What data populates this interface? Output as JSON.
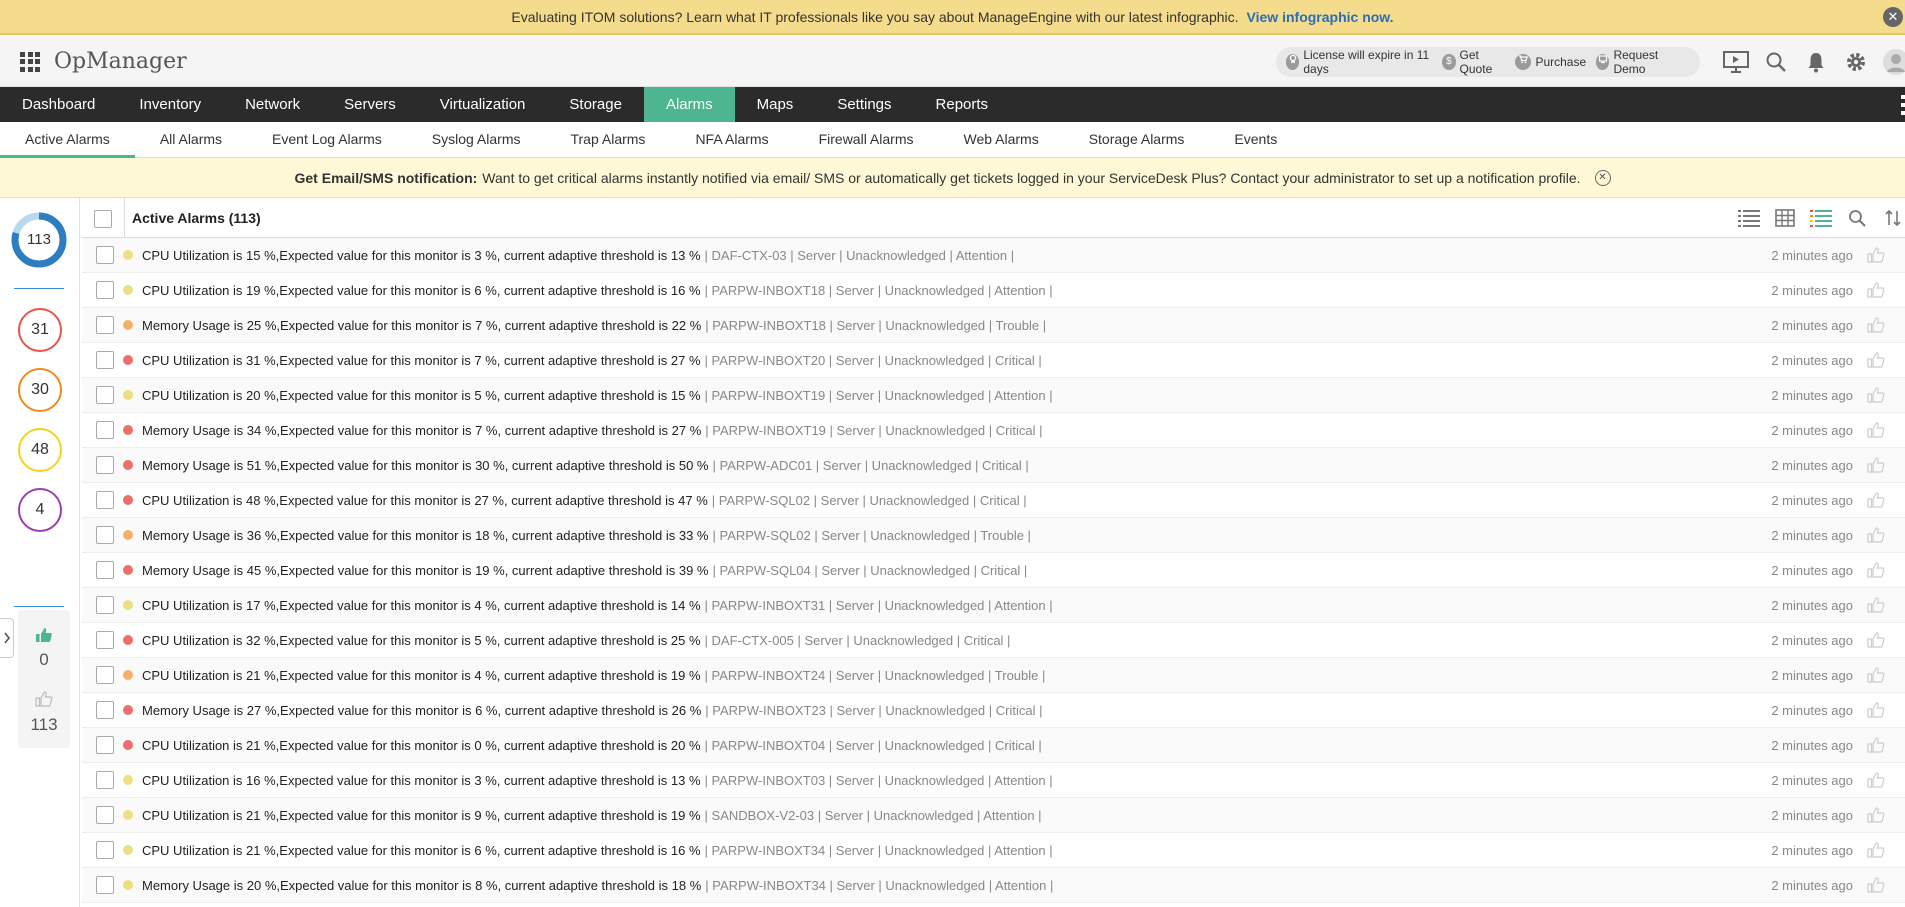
{
  "banner": {
    "text": "Evaluating ITOM solutions? Learn what IT professionals like you say about ManageEngine with our latest infographic.",
    "link": "View infographic now.",
    "close_glyph": "✕"
  },
  "header": {
    "brand": "OpManager",
    "license": "License will expire in 11 days",
    "get_quote": "Get Quote",
    "purchase": "Purchase",
    "request_demo": "Request Demo",
    "quote_glyph": "$",
    "icons": [
      "presentation-icon",
      "search-icon",
      "bell-icon",
      "gear-icon",
      "user-avatar"
    ]
  },
  "nav": {
    "items": [
      "Dashboard",
      "Inventory",
      "Network",
      "Servers",
      "Virtualization",
      "Storage",
      "Alarms",
      "Maps",
      "Settings",
      "Reports"
    ],
    "active": "Alarms"
  },
  "subnav": {
    "items": [
      "Active Alarms",
      "All Alarms",
      "Event Log Alarms",
      "Syslog Alarms",
      "Trap Alarms",
      "NFA Alarms",
      "Firewall Alarms",
      "Web Alarms",
      "Storage Alarms",
      "Events"
    ],
    "active": "Active Alarms"
  },
  "notification": {
    "title": "Get Email/SMS notification:",
    "text": "Want to get critical alarms instantly notified via email/ SMS or automatically get tickets logged in your ServiceDesk Plus? Contact your administrator to set up a notification profile.",
    "close_glyph": "✕"
  },
  "sidebar": {
    "total": "113",
    "severities": [
      {
        "name": "critical",
        "count": "31",
        "color": "#e8534a"
      },
      {
        "name": "trouble",
        "count": "30",
        "color": "#f08a1c"
      },
      {
        "name": "attention",
        "count": "48",
        "color": "#f2d21b"
      },
      {
        "name": "service-down",
        "count": "4",
        "color": "#9b3fb0"
      }
    ],
    "acknowledged": "0",
    "unacknowledged": "113"
  },
  "list": {
    "title": "Active Alarms (113)",
    "colors": {
      "Critical": "#ee6e6a",
      "Trouble": "#f4b06a",
      "Attention": "#ece082"
    },
    "rows": [
      {
        "msg": "CPU Utilization is 15 %,Expected value for this monitor is 3 %, current adaptive threshold is 13 %",
        "meta": "| DAF-CTX-03 | Server | Unacknowledged | Attention |",
        "severity": "Attention",
        "time": "2 minutes ago"
      },
      {
        "msg": "CPU Utilization is 19 %,Expected value for this monitor is 6 %, current adaptive threshold is 16 %",
        "meta": "| PARPW-INBOXT18 | Server | Unacknowledged | Attention |",
        "severity": "Attention",
        "time": "2 minutes ago"
      },
      {
        "msg": "Memory Usage is 25 %,Expected value for this monitor is 7 %, current adaptive threshold is 22 %",
        "meta": "| PARPW-INBOXT18 | Server | Unacknowledged | Trouble |",
        "severity": "Trouble",
        "time": "2 minutes ago"
      },
      {
        "msg": "CPU Utilization is 31 %,Expected value for this monitor is 7 %, current adaptive threshold is 27 %",
        "meta": "| PARPW-INBOXT20 | Server | Unacknowledged | Critical |",
        "severity": "Critical",
        "time": "2 minutes ago"
      },
      {
        "msg": "CPU Utilization is 20 %,Expected value for this monitor is 5 %, current adaptive threshold is 15 %",
        "meta": "| PARPW-INBOXT19 | Server | Unacknowledged | Attention |",
        "severity": "Attention",
        "time": "2 minutes ago"
      },
      {
        "msg": "Memory Usage is 34 %,Expected value for this monitor is 7 %, current adaptive threshold is 27 %",
        "meta": "| PARPW-INBOXT19 | Server | Unacknowledged | Critical |",
        "severity": "Critical",
        "time": "2 minutes ago"
      },
      {
        "msg": "Memory Usage is 51 %,Expected value for this monitor is 30 %, current adaptive threshold is 50 %",
        "meta": "| PARPW-ADC01 | Server | Unacknowledged | Critical |",
        "severity": "Critical",
        "time": "2 minutes ago"
      },
      {
        "msg": "CPU Utilization is 48 %,Expected value for this monitor is 27 %, current adaptive threshold is 47 %",
        "meta": "| PARPW-SQL02 | Server | Unacknowledged | Critical |",
        "severity": "Critical",
        "time": "2 minutes ago"
      },
      {
        "msg": "Memory Usage is 36 %,Expected value for this monitor is 18 %, current adaptive threshold is 33 %",
        "meta": "| PARPW-SQL02 | Server | Unacknowledged | Trouble |",
        "severity": "Trouble",
        "time": "2 minutes ago"
      },
      {
        "msg": "Memory Usage is 45 %,Expected value for this monitor is 19 %, current adaptive threshold is 39 %",
        "meta": "| PARPW-SQL04 | Server | Unacknowledged | Critical |",
        "severity": "Critical",
        "time": "2 minutes ago"
      },
      {
        "msg": "CPU Utilization is 17 %,Expected value for this monitor is 4 %, current adaptive threshold is 14 %",
        "meta": "| PARPW-INBOXT31 | Server | Unacknowledged | Attention |",
        "severity": "Attention",
        "time": "2 minutes ago"
      },
      {
        "msg": "CPU Utilization is 32 %,Expected value for this monitor is 5 %, current adaptive threshold is 25 %",
        "meta": "| DAF-CTX-005 | Server | Unacknowledged | Critical |",
        "severity": "Critical",
        "time": "2 minutes ago"
      },
      {
        "msg": "CPU Utilization is 21 %,Expected value for this monitor is 4 %, current adaptive threshold is 19 %",
        "meta": "| PARPW-INBOXT24 | Server | Unacknowledged | Trouble |",
        "severity": "Trouble",
        "time": "2 minutes ago"
      },
      {
        "msg": "Memory Usage is 27 %,Expected value for this monitor is 6 %, current adaptive threshold is 26 %",
        "meta": "| PARPW-INBOXT23 | Server | Unacknowledged | Critical |",
        "severity": "Critical",
        "time": "2 minutes ago"
      },
      {
        "msg": "CPU Utilization is 21 %,Expected value for this monitor is 0 %, current adaptive threshold is 20 %",
        "meta": "| PARPW-INBOXT04 | Server | Unacknowledged | Critical |",
        "severity": "Critical",
        "time": "2 minutes ago"
      },
      {
        "msg": "CPU Utilization is 16 %,Expected value for this monitor is 3 %, current adaptive threshold is 13 %",
        "meta": "| PARPW-INBOXT03 | Server | Unacknowledged | Attention |",
        "severity": "Attention",
        "time": "2 minutes ago"
      },
      {
        "msg": "CPU Utilization is 21 %,Expected value for this monitor is 9 %, current adaptive threshold is 19 %",
        "meta": "| SANDBOX-V2-03 | Server | Unacknowledged | Attention |",
        "severity": "Attention",
        "time": "2 minutes ago"
      },
      {
        "msg": "CPU Utilization is 21 %,Expected value for this monitor is 6 %, current adaptive threshold is 16 %",
        "meta": "| PARPW-INBOXT34 | Server | Unacknowledged | Attention |",
        "severity": "Attention",
        "time": "2 minutes ago"
      },
      {
        "msg": "Memory Usage is 20 %,Expected value for this monitor is 8 %, current adaptive threshold is 18 %",
        "meta": "| PARPW-INBOXT34 | Server | Unacknowledged | Attention |",
        "severity": "Attention",
        "time": "2 minutes ago"
      }
    ]
  }
}
